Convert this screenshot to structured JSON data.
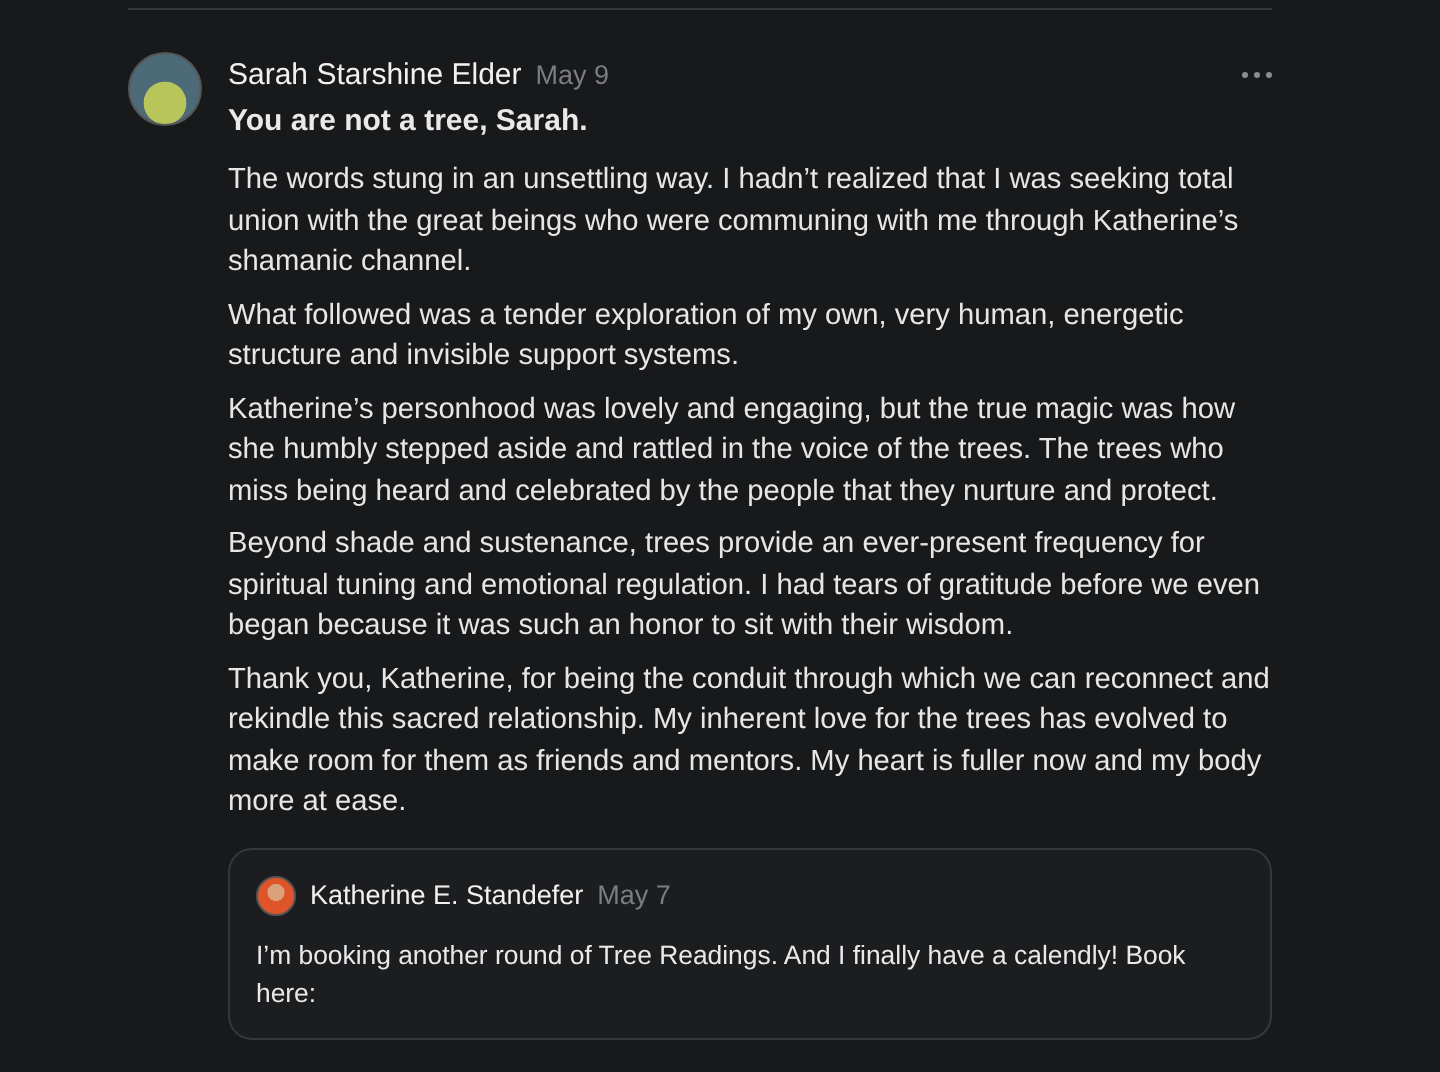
{
  "comment": {
    "author": "Sarah Starshine Elder",
    "date": "May 9",
    "title": "You are not a tree, Sarah.",
    "paragraphs": [
      "The words stung in an unsettling way. I hadn’t realized that I was seeking total union with the great beings who were communing with me through Katherine’s shamanic channel.",
      "What followed was a tender exploration of my own, very human, energetic structure and invisible support systems.",
      "Katherine’s personhood was lovely and engaging, but the true magic was how she humbly stepped aside and rattled in the voice of the trees. The trees who miss being heard and celebrated by the people that they nurture and protect.",
      "Beyond shade and sustenance, trees provide an ever-present frequency for spiritual tuning and emotional regulation. I had tears of gratitude before we even began because it was such an honor to sit with their wisdom.",
      "Thank you, Katherine, for being the conduit through which we can reconnect and rekindle this sacred relationship. My inherent love for the trees has evolved to make room for them as friends and mentors. My heart is fuller now and my body more at ease."
    ]
  },
  "reply": {
    "author": "Katherine E. Standefer",
    "date": "May 7",
    "text": "I’m booking another round of Tree Readings. And I finally have a calendly! Book here:"
  }
}
